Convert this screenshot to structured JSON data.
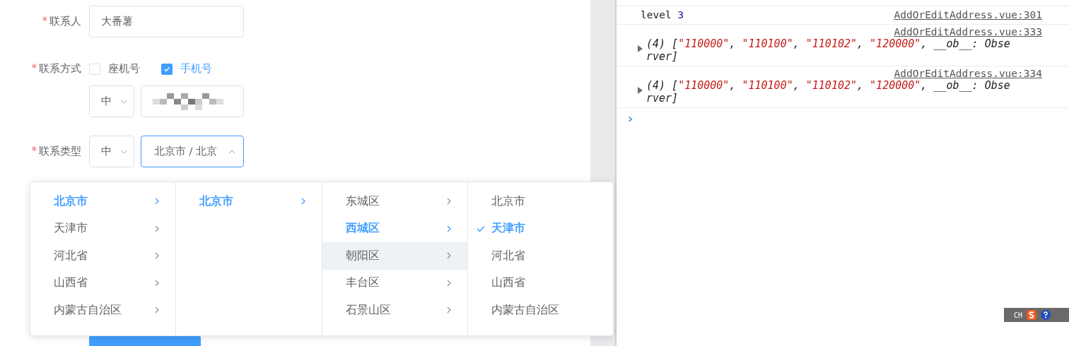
{
  "form": {
    "contact_person": {
      "label": "联系人",
      "required_mark": "*",
      "value": "大番薯"
    },
    "contact_method": {
      "label": "联系方式",
      "required_mark": "*",
      "options": [
        {
          "label": "座机号",
          "checked": false
        },
        {
          "label": "手机号",
          "checked": true
        }
      ],
      "prefix": "中"
    },
    "contact_type": {
      "label": "联系类型",
      "required_mark": "*",
      "prefix": "中",
      "value": "北京市 / 北京",
      "expanded": true
    }
  },
  "cascader": {
    "columns": [
      {
        "items": [
          {
            "label": "北京市",
            "selected": true,
            "highlighted": false,
            "has_children": true
          },
          {
            "label": "天津市",
            "selected": false,
            "highlighted": false,
            "has_children": true
          },
          {
            "label": "河北省",
            "selected": false,
            "highlighted": false,
            "has_children": true
          },
          {
            "label": "山西省",
            "selected": false,
            "highlighted": false,
            "has_children": true
          },
          {
            "label": "内蒙古自治区",
            "selected": false,
            "highlighted": false,
            "has_children": true
          }
        ]
      },
      {
        "items": [
          {
            "label": "北京市",
            "selected": true,
            "highlighted": false,
            "has_children": true
          }
        ]
      },
      {
        "items": [
          {
            "label": "东城区",
            "selected": false,
            "highlighted": false,
            "has_children": true
          },
          {
            "label": "西城区",
            "selected": true,
            "highlighted": false,
            "has_children": true
          },
          {
            "label": "朝阳区",
            "selected": false,
            "highlighted": true,
            "has_children": true
          },
          {
            "label": "丰台区",
            "selected": false,
            "highlighted": false,
            "has_children": true
          },
          {
            "label": "石景山区",
            "selected": false,
            "highlighted": false,
            "has_children": true
          }
        ]
      },
      {
        "items": [
          {
            "label": "北京市",
            "selected": false,
            "highlighted": false,
            "has_children": false
          },
          {
            "label": "天津市",
            "selected": true,
            "highlighted": false,
            "has_children": false
          },
          {
            "label": "河北省",
            "selected": false,
            "highlighted": false,
            "has_children": false
          },
          {
            "label": "山西省",
            "selected": false,
            "highlighted": false,
            "has_children": false
          },
          {
            "label": "内蒙古自治区",
            "selected": false,
            "highlighted": false,
            "has_children": false
          }
        ]
      }
    ]
  },
  "console": {
    "entries": [
      {
        "kind": "log",
        "text": "level",
        "number": "3",
        "source": "AddOrEditAddress.vue:301"
      },
      {
        "kind": "array",
        "source": "AddOrEditAddress.vue:333",
        "tokens": [
          {
            "kind": "plain",
            "text": "(4) ["
          },
          {
            "kind": "string",
            "text": "\"110000\""
          },
          {
            "kind": "plain",
            "text": ", "
          },
          {
            "kind": "string",
            "text": "\"110100\""
          },
          {
            "kind": "plain",
            "text": ", "
          },
          {
            "kind": "string",
            "text": "\"110102\""
          },
          {
            "kind": "plain",
            "text": ", "
          },
          {
            "kind": "string",
            "text": "\"120000\""
          },
          {
            "kind": "plain",
            "text": ", __ob__: Observer]"
          }
        ]
      },
      {
        "kind": "array",
        "source": "AddOrEditAddress.vue:334",
        "tokens": [
          {
            "kind": "plain",
            "text": "(4) ["
          },
          {
            "kind": "string",
            "text": "\"110000\""
          },
          {
            "kind": "plain",
            "text": ", "
          },
          {
            "kind": "string",
            "text": "\"110100\""
          },
          {
            "kind": "plain",
            "text": ", "
          },
          {
            "kind": "string",
            "text": "\"110102\""
          },
          {
            "kind": "plain",
            "text": ", "
          },
          {
            "kind": "string",
            "text": "\"120000\""
          },
          {
            "kind": "plain",
            "text": ", __ob__: Observer]"
          }
        ]
      }
    ],
    "prompt": "›"
  },
  "ime_bar": {
    "language": "CH"
  }
}
